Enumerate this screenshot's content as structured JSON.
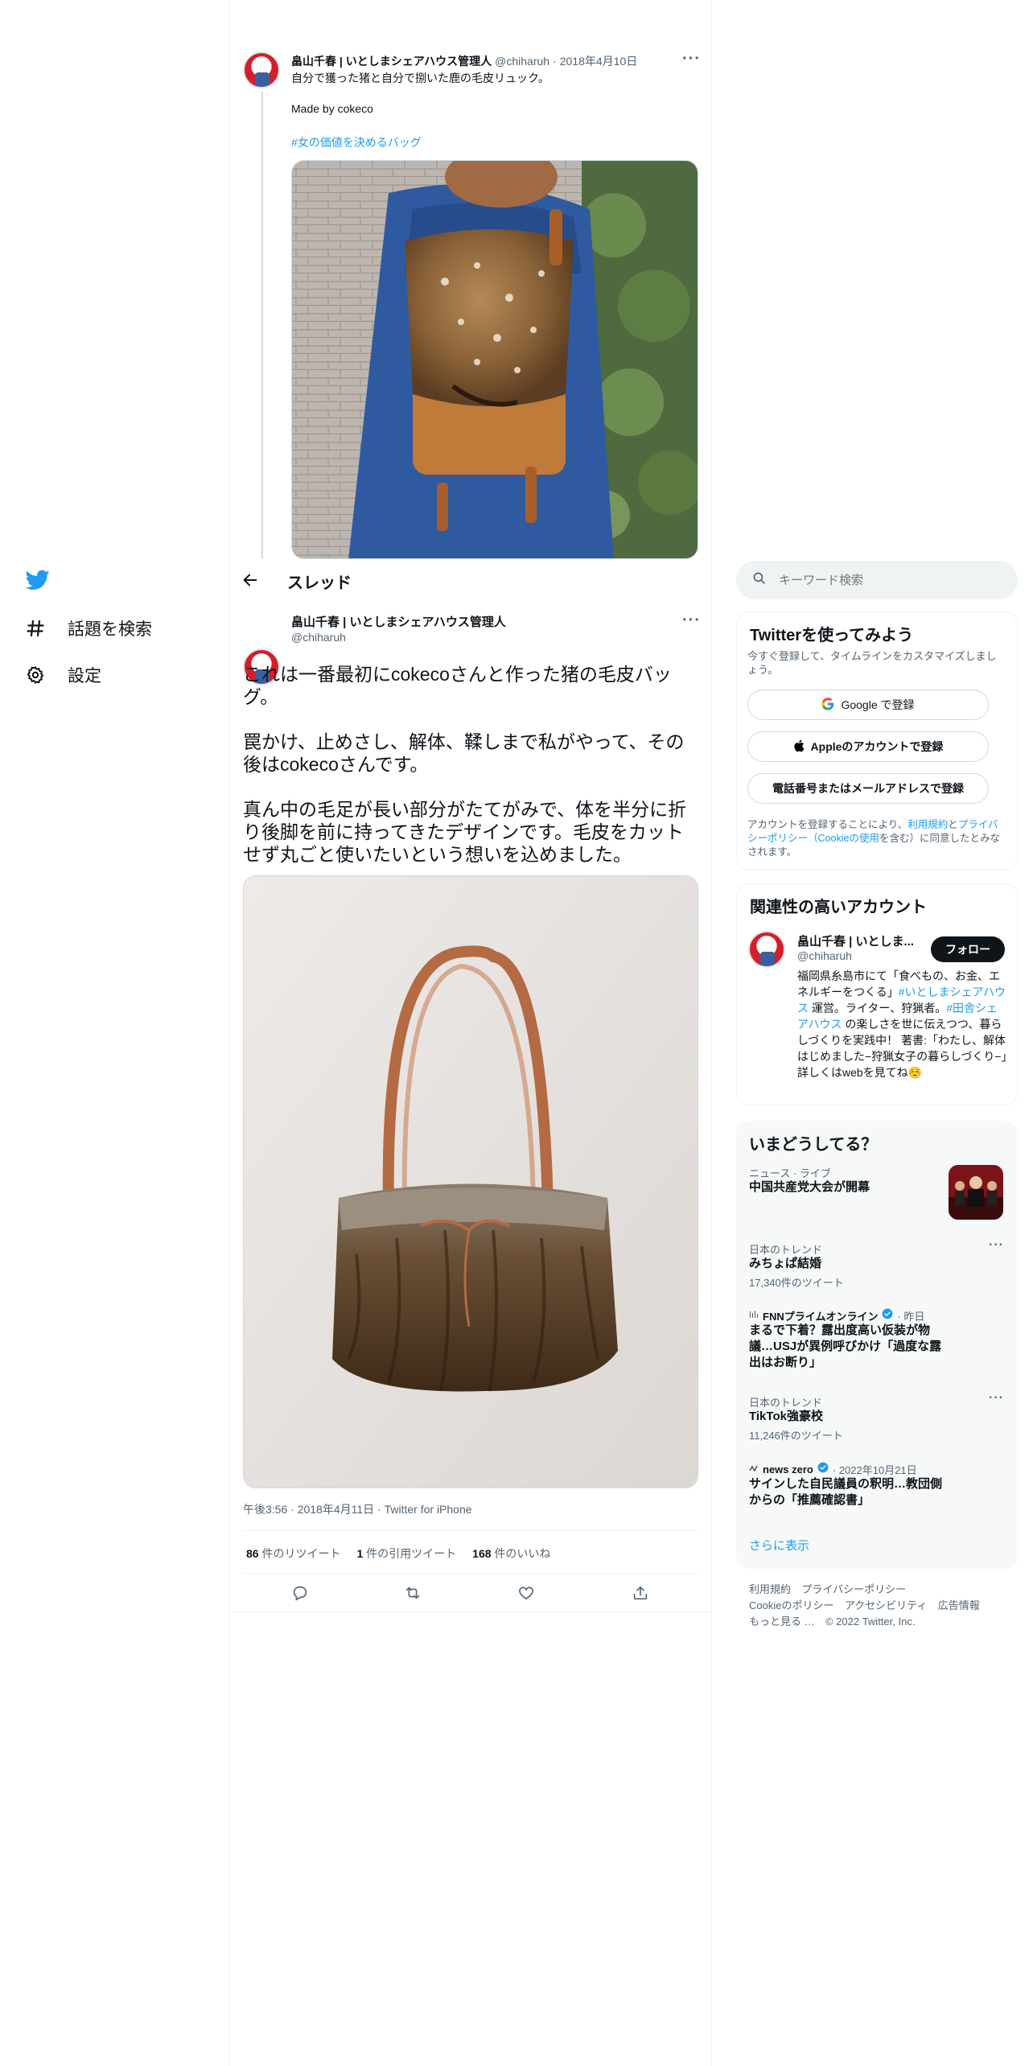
{
  "nav": {
    "items": [
      {
        "label": "話題を検索",
        "icon": "hashtag-icon"
      },
      {
        "label": "設定",
        "icon": "gear-icon"
      }
    ]
  },
  "header": {
    "title": "スレッド"
  },
  "parent_tweet": {
    "author_name": "畠山千春 | いとしまシェアハウス管理人",
    "handle": "@chiharuh",
    "sep": "·",
    "date": "2018年4月10日",
    "line1": "自分で獲った猪と自分で捌いた鹿の毛皮リュック。",
    "line2": "Made by cokeco",
    "hashtag": "#女の価値を決めるバッグ"
  },
  "main_tweet": {
    "author_name": "畠山千春 | いとしまシェアハウス管理人",
    "handle": "@chiharuh",
    "para1": "これは一番最初にcokecoさんと作った猪の毛皮バッグ。",
    "para2": "罠かけ、止めさし、解体、鞣しまで私がやって、その後はcokecoさんです。",
    "para3": "真ん中の毛足が長い部分がたてがみで、体を半分に折り後脚を前に持ってきたデザインです。毛皮をカットせず丸ごと使いたいという想いを込めました。",
    "meta": "午後3:56 · 2018年4月11日 · Twitter for iPhone",
    "retweets_count": "86",
    "retweets_label": "件のリツイート",
    "quotes_count": "1",
    "quotes_label": "件の引用ツイート",
    "likes_count": "168",
    "likes_label": "件のいいね"
  },
  "search": {
    "placeholder": "キーワード検索"
  },
  "signup": {
    "title": "Twitterを使ってみよう",
    "subtitle": "今すぐ登録して、タイムラインをカスタマイズしましょう。",
    "google_label": "Google で登録",
    "apple_label": "Appleのアカウントで登録",
    "phone_label": "電話番号またはメールアドレスで登録",
    "terms_prefix": "アカウントを登録することにより、",
    "terms_link": "利用規約",
    "terms_and": "と",
    "privacy_link": "プライバシーポリシー",
    "cookie_open": "（",
    "cookie_link": "Cookieの使用",
    "terms_suffix": "を含む）に同意したとみなされます。"
  },
  "related": {
    "title": "関連性の高いアカウント",
    "name": "畠山千春 | いとしま...",
    "handle": "@chiharuh",
    "follow_label": "フォロー",
    "bio_1": "福岡県糸島市にて「食べもの、お金、エネルギーをつくる」",
    "bio_tag1": "#いとしまシェアハウス",
    "bio_2": " 運営。ライター、狩猟者。",
    "bio_tag2": "#田舎シェアハウス",
    "bio_3": " の楽しさを世に伝えつつ、暮らしづくりを実践中！ 著書:「わたし、解体はじめました−狩猟女子の暮らしづくり−」詳しくはwebを見てね☺️"
  },
  "trends": {
    "title": "いまどうしてる？",
    "items": [
      {
        "meta": "ニュース · ライブ",
        "title": "中国共産党大会が開幕"
      },
      {
        "meta": "日本のトレンド",
        "title": "みちょぱ結婚",
        "count": "17,340件のツイート"
      },
      {
        "source": "FNNプライムオンライン",
        "time": "· 昨日",
        "title": "まるで下着？露出度高い仮装が物議…USJが異例呼びかけ「過度な露出はお断り」"
      },
      {
        "meta": "日本のトレンド",
        "title": "TikTok強豪校",
        "count": "11,246件のツイート"
      },
      {
        "source": "news zero",
        "time": "· 2022年10月21日",
        "title": "サインした自民議員の釈明…教団側からの「推薦確認書」"
      }
    ],
    "show_more": "さらに表示"
  },
  "footer": {
    "links": [
      "利用規約",
      "プライバシーポリシー",
      "Cookieのポリシー",
      "アクセシビリティ",
      "広告情報",
      "もっと見る …"
    ],
    "copyright": "© 2022 Twitter, Inc."
  },
  "colors": {
    "accent": "#1d9bf0",
    "text": "#0f1419",
    "muted": "#536471",
    "border": "#eff3f4"
  }
}
